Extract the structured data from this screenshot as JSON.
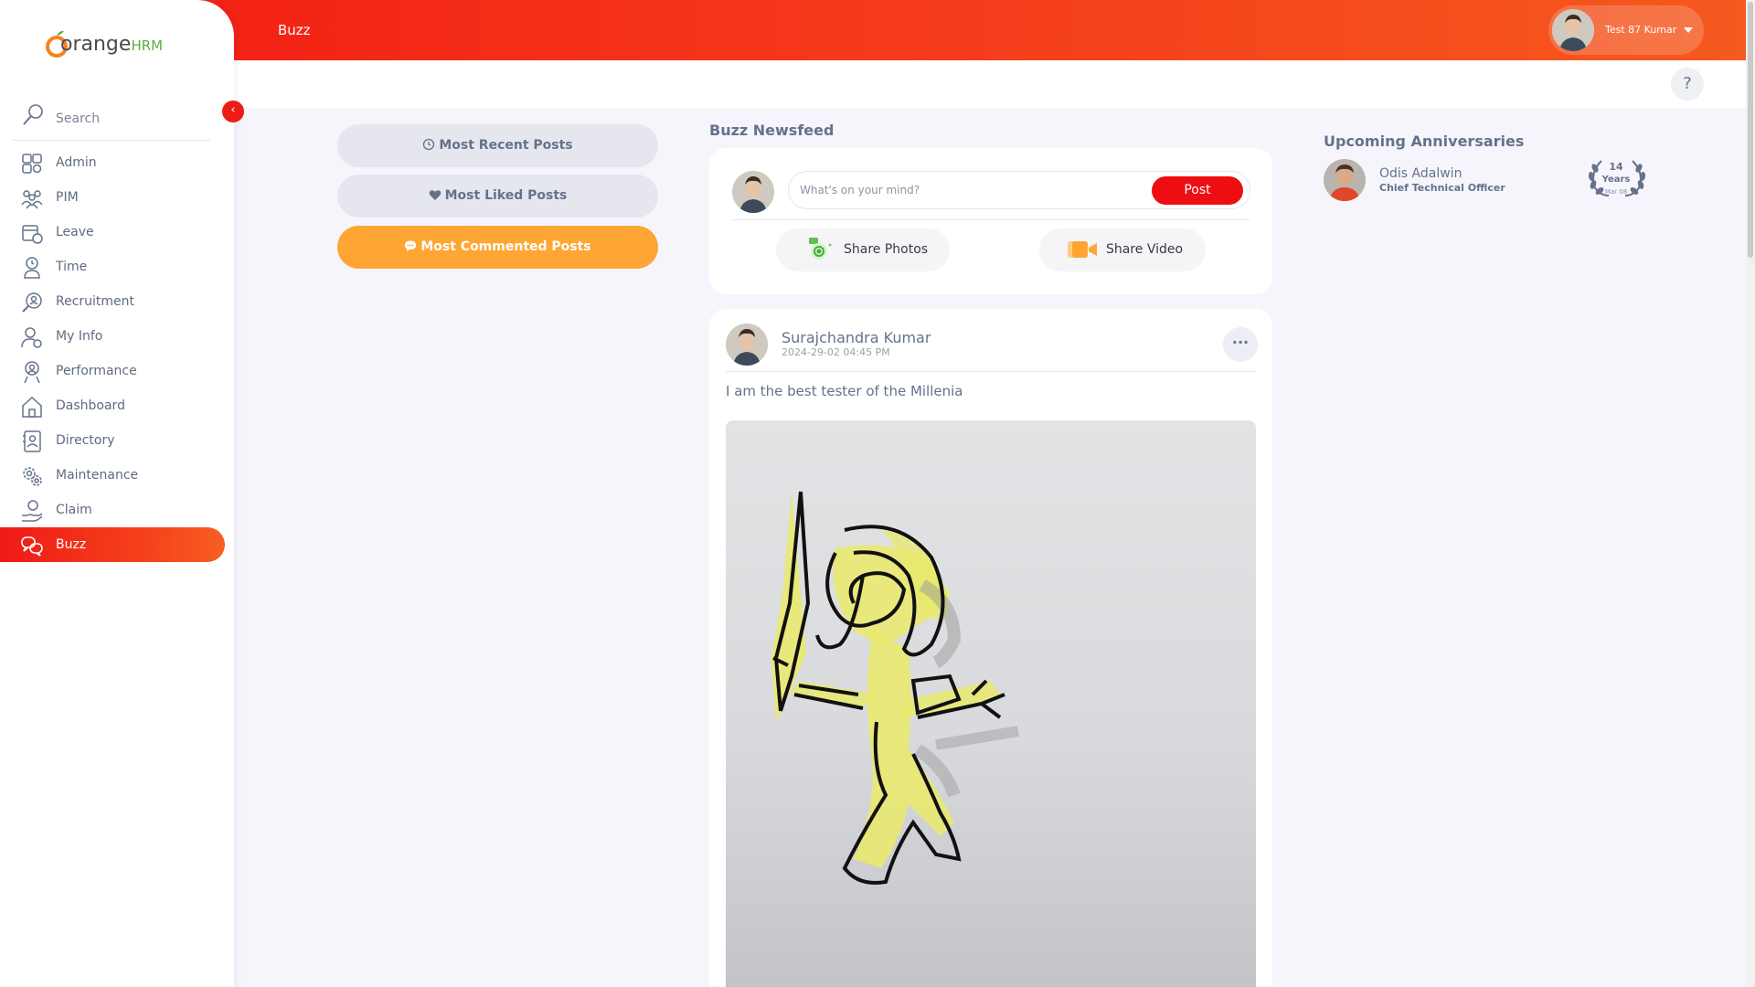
{
  "app": {
    "logo_text": "orange",
    "logo_suffix": "HRM"
  },
  "topbar": {
    "title": "Buzz",
    "user_name": "Test 87 Kumar"
  },
  "help": {
    "label": "?"
  },
  "sidebar": {
    "search_label": "Search",
    "items": [
      {
        "label": "Admin",
        "icon": "admin-icon"
      },
      {
        "label": "PIM",
        "icon": "pim-icon"
      },
      {
        "label": "Leave",
        "icon": "leave-icon"
      },
      {
        "label": "Time",
        "icon": "time-icon"
      },
      {
        "label": "Recruitment",
        "icon": "recruitment-icon"
      },
      {
        "label": "My Info",
        "icon": "my-info-icon"
      },
      {
        "label": "Performance",
        "icon": "performance-icon"
      },
      {
        "label": "Dashboard",
        "icon": "dashboard-icon"
      },
      {
        "label": "Directory",
        "icon": "directory-icon"
      },
      {
        "label": "Maintenance",
        "icon": "maintenance-icon"
      },
      {
        "label": "Claim",
        "icon": "claim-icon"
      },
      {
        "label": "Buzz",
        "icon": "buzz-icon",
        "active": true
      }
    ]
  },
  "filters": {
    "most_recent": "Most Recent Posts",
    "most_liked": "Most Liked Posts",
    "most_commented": "Most Commented Posts",
    "active": "most_commented"
  },
  "newsfeed": {
    "title": "Buzz Newsfeed",
    "composer": {
      "placeholder": "What's on your mind?",
      "post_label": "Post"
    },
    "share_photos": "Share Photos",
    "share_video": "Share Video",
    "post": {
      "author": "Surajchandra Kumar",
      "date": "2024-29-02 04:45 PM",
      "text": "I am the best tester of the Millenia",
      "more_label": "···"
    }
  },
  "anniversaries": {
    "title": "Upcoming Anniversaries",
    "items": [
      {
        "name": "Odis Adalwin",
        "role": "Chief Technical Officer",
        "years": "14",
        "years_label": "Years",
        "date": "Mar 08"
      }
    ]
  },
  "colors": {
    "accent": "#ef1a15",
    "filter_active": "#ffa534",
    "text": "#64728c"
  }
}
